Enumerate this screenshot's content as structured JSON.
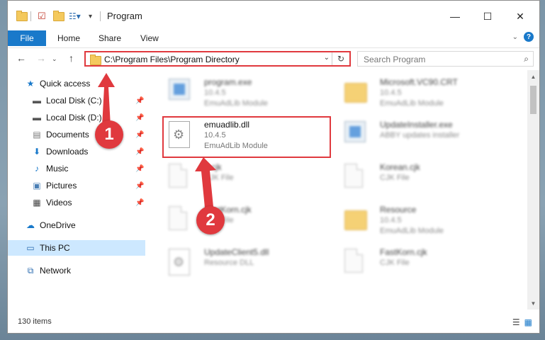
{
  "window": {
    "title": "Program",
    "controls": {
      "minimize": "—",
      "maximize": "☐",
      "close": "✕"
    }
  },
  "ribbon": {
    "tabs": [
      {
        "label": "File"
      },
      {
        "label": "Home"
      },
      {
        "label": "Share"
      },
      {
        "label": "View"
      }
    ]
  },
  "address_bar": {
    "path": "C:\\Program Files\\Program Directory"
  },
  "search": {
    "placeholder": "Search Program"
  },
  "sidebar": {
    "items": [
      {
        "label": "Quick access",
        "icon": "star-icon"
      },
      {
        "label": "Local Disk (C:)",
        "icon": "drive-icon",
        "pinned": true
      },
      {
        "label": "Local Disk (D:)",
        "icon": "drive-icon",
        "pinned": true
      },
      {
        "label": "Documents",
        "icon": "documents-icon",
        "pinned": true
      },
      {
        "label": "Downloads",
        "icon": "download-icon",
        "pinned": true
      },
      {
        "label": "Music",
        "icon": "music-icon",
        "pinned": true
      },
      {
        "label": "Pictures",
        "icon": "pictures-icon",
        "pinned": true
      },
      {
        "label": "Videos",
        "icon": "videos-icon",
        "pinned": true
      },
      {
        "label": "OneDrive",
        "icon": "cloud-icon"
      },
      {
        "label": "This PC",
        "icon": "computer-icon",
        "selected": true
      },
      {
        "label": "Network",
        "icon": "network-icon"
      }
    ]
  },
  "files": [
    {
      "name": "program.exe",
      "line2": "10.4.5",
      "line3": "EmuAdLib Module"
    },
    {
      "name": "Microsoft.VC90.CRT",
      "line2": "10.4.5",
      "line3": "EmuAdLib Module"
    },
    {
      "name": "emuadlib.dll",
      "line2": "10.4.5",
      "line3": "EmuAdLib Module"
    },
    {
      "name": "UpdateInstaller.exe",
      "line2": "ABBY updates installer",
      "line3": ""
    },
    {
      "name": "...cjk",
      "line2": "CJK File",
      "line3": ""
    },
    {
      "name": "Korean.cjk",
      "line2": "CJK File",
      "line3": ""
    },
    {
      "name": "FastKorn.cjk",
      "line2": "CJK File",
      "line3": ""
    },
    {
      "name": "Resource",
      "line2": "10.4.5",
      "line3": "EmuAdLib Module"
    },
    {
      "name": "UpdateClient5.dll",
      "line2": "Resource DLL",
      "line3": ""
    },
    {
      "name": "FastKorn.cjk",
      "line2": "CJK File",
      "line3": ""
    }
  ],
  "status": {
    "item_count": "130 items"
  },
  "annotations": {
    "step1": "1",
    "step2": "2"
  },
  "colors": {
    "accent": "#1979ca",
    "highlight": "#e0393e",
    "selected": "#cde8ff"
  }
}
